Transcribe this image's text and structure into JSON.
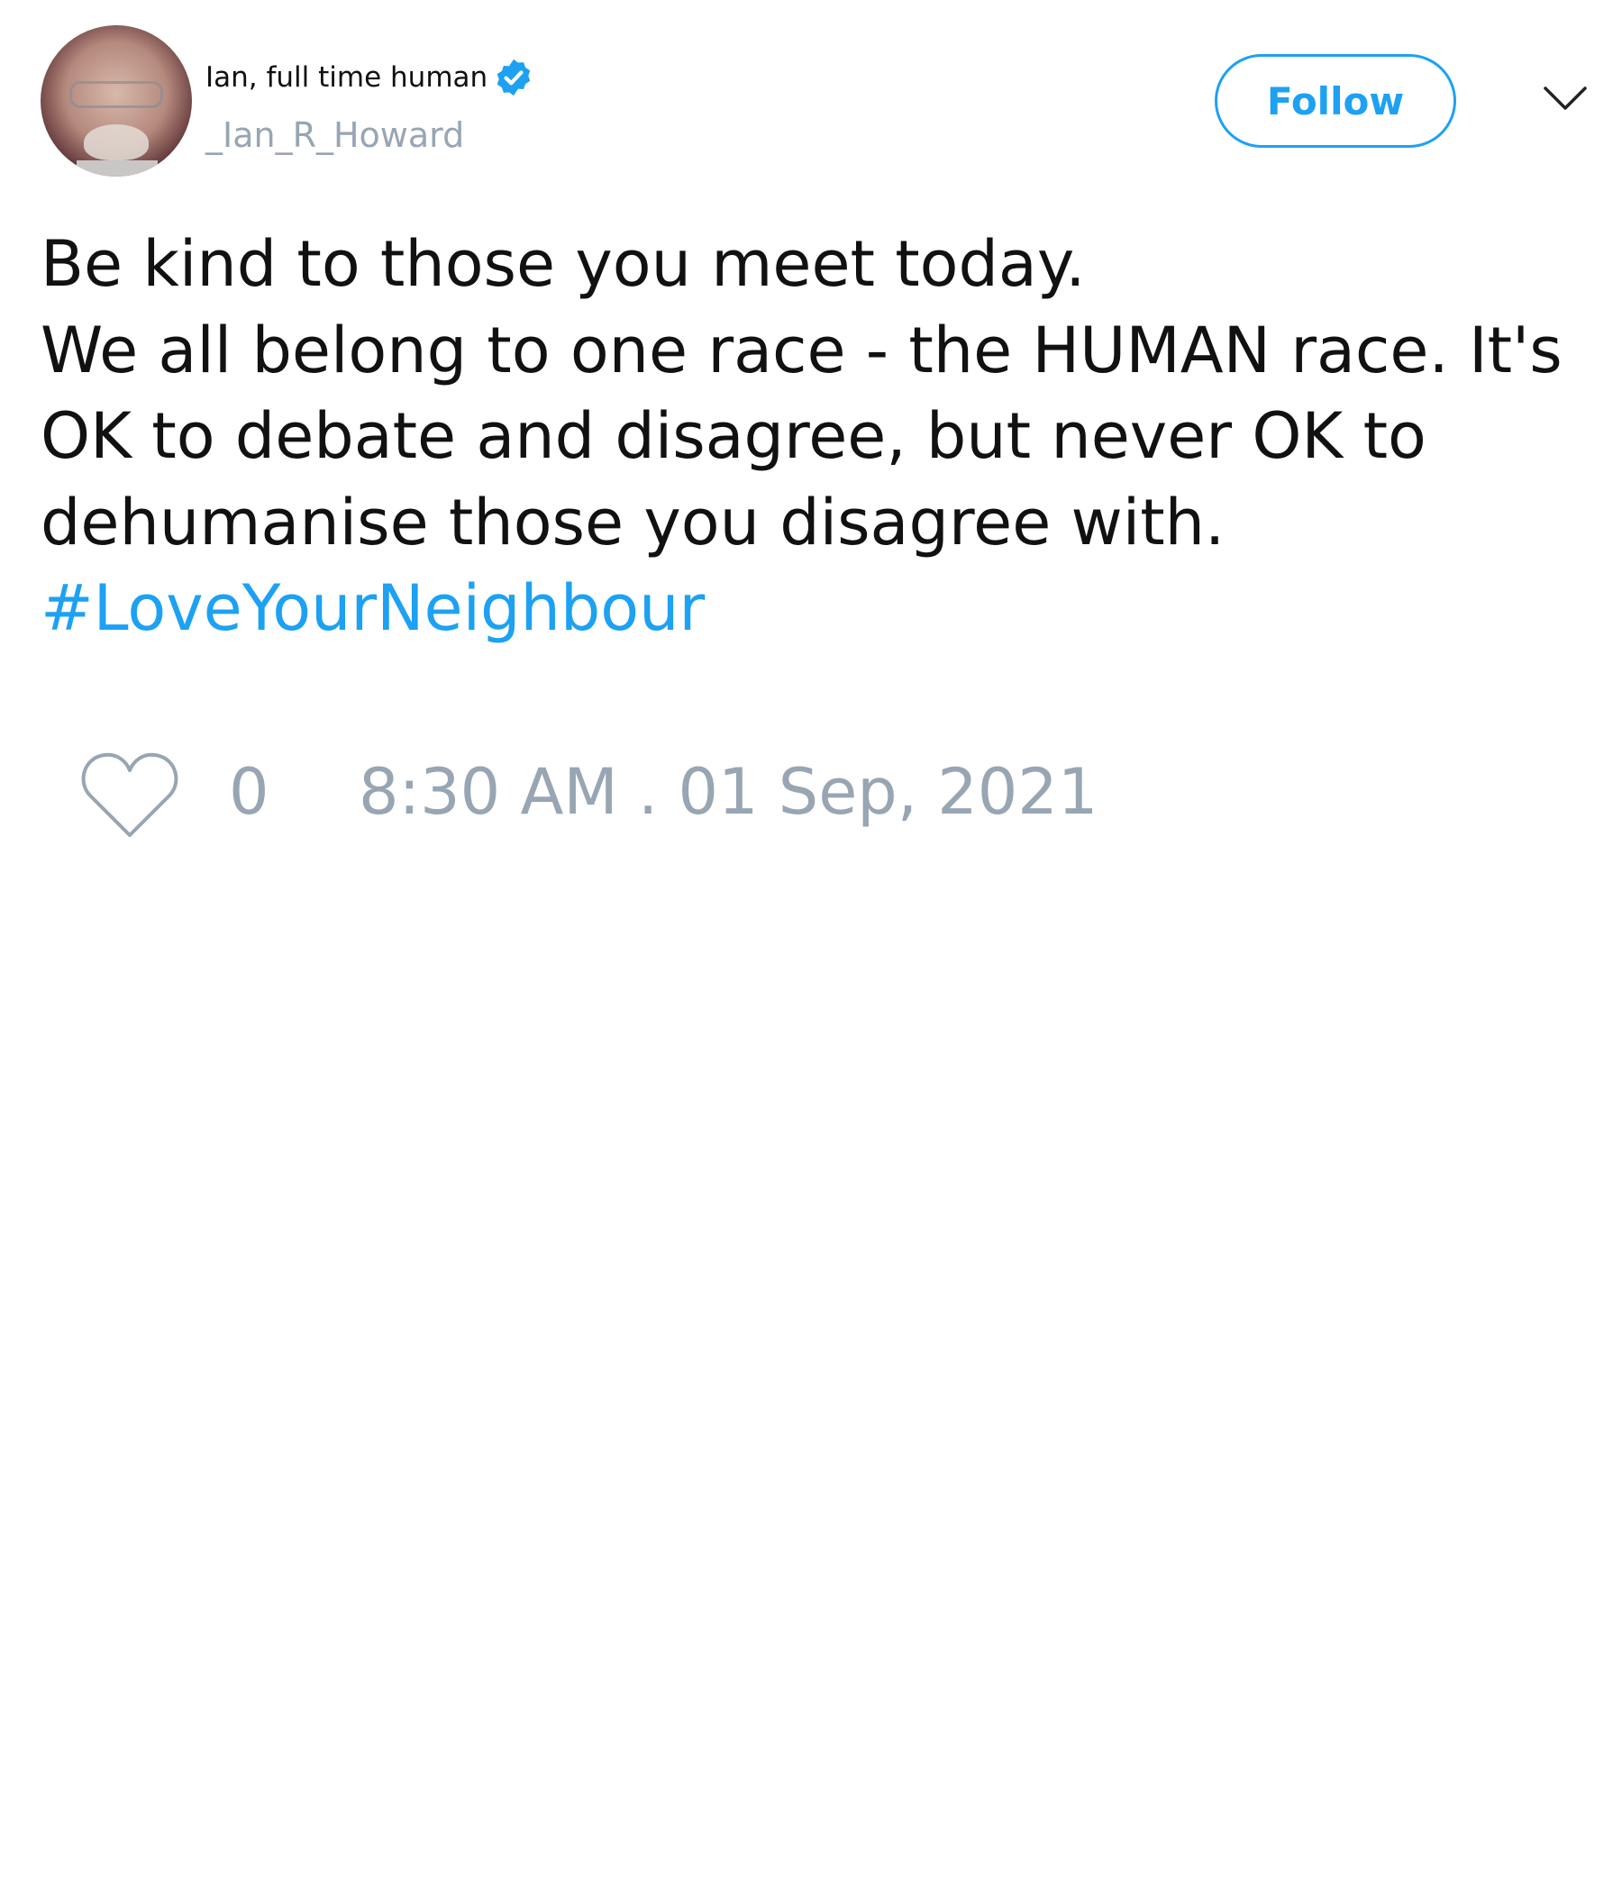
{
  "author": {
    "display_name": "Ian, full time human",
    "handle": "_Ian_R_Howard",
    "verified": true
  },
  "header": {
    "follow_label": "Follow",
    "menu_icon": "chevron-down-icon",
    "verified_icon": "verified-badge-icon"
  },
  "tweet": {
    "lines": [
      "Be kind to those you meet today.",
      "We all belong to one race - the HUMAN race. It's",
      "OK to debate and disagree, but never OK to",
      "dehumanise those you disagree with."
    ],
    "hashtag": "#LoveYourNeighbour"
  },
  "footer": {
    "like_icon": "heart-icon",
    "like_count": "0",
    "timestamp": "8:30 AM . 01 Sep, 2021"
  },
  "colors": {
    "accent": "#1da1f2",
    "muted": "#98a5b3",
    "text": "#111111",
    "background": "#ffffff"
  }
}
